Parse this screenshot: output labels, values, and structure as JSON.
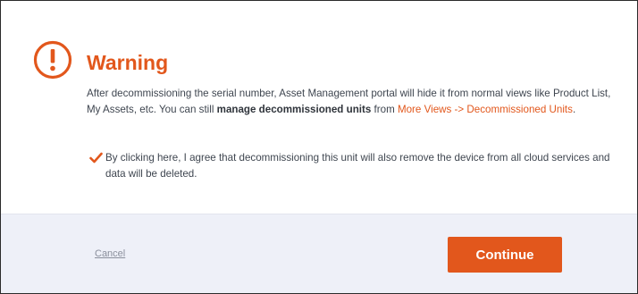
{
  "dialog": {
    "icon": "exclamation-circle-icon",
    "title": "Warning",
    "message": {
      "part1": "After decommissioning the serial number, Asset Management portal will hide it from normal views like Product List, My Assets, etc. You can still ",
      "bold": "manage decommissioned units",
      "part2": " from ",
      "link": "More Views -> Decommissioned Units",
      "part3": "."
    },
    "agreement": {
      "checked": true,
      "icon": "checkmark-icon",
      "text": "By clicking here, I agree that decommissioning this unit will also remove the device from all cloud services and data will be deleted."
    }
  },
  "footer": {
    "cancel_label": "Cancel",
    "continue_label": "Continue"
  },
  "colors": {
    "accent": "#e2571c",
    "footer_bg": "#eef0f8",
    "text": "#3f4650",
    "cancel_text": "#8a8f9c"
  }
}
